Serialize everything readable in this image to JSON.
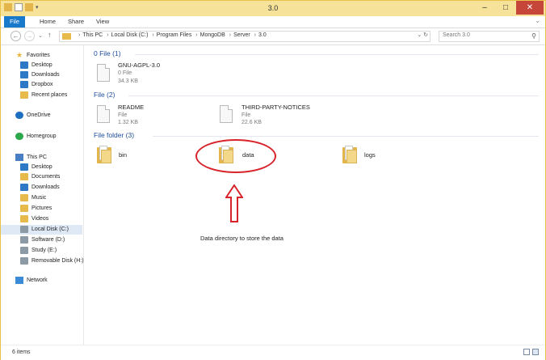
{
  "window": {
    "title": "3.0"
  },
  "ribbon": {
    "tabs": [
      "File",
      "Home",
      "Share",
      "View"
    ]
  },
  "address": {
    "crumbs": [
      "This PC",
      "Local Disk (C:)",
      "Program Files",
      "MongoDB",
      "Server",
      "3.0"
    ],
    "search_placeholder": "Search 3.0"
  },
  "nav": {
    "favorites": {
      "label": "Favorites",
      "items": [
        "Desktop",
        "Downloads",
        "Dropbox",
        "Recent places"
      ]
    },
    "onedrive": "OneDrive",
    "homegroup": "Homegroup",
    "thispc": {
      "label": "This PC",
      "items": [
        "Desktop",
        "Documents",
        "Downloads",
        "Music",
        "Pictures",
        "Videos",
        "Local Disk (C:)",
        "Software (D:)",
        "Study (E:)",
        "Removable Disk (H:)"
      ]
    },
    "network": "Network"
  },
  "groups": [
    {
      "header": "0 File (1)",
      "items": [
        {
          "name": "GNU-AGPL-3.0",
          "type": "0 File",
          "size": "34.3 KB"
        }
      ]
    },
    {
      "header": "File (2)",
      "items": [
        {
          "name": "README",
          "type": "File",
          "size": "1.32 KB"
        },
        {
          "name": "THIRD-PARTY-NOTICES",
          "type": "File",
          "size": "22.6 KB"
        }
      ]
    },
    {
      "header": "File folder (3)",
      "items": [
        {
          "name": "bin"
        },
        {
          "name": "data"
        },
        {
          "name": "logs"
        }
      ]
    }
  ],
  "annotation": {
    "text": "Data directory to store the data",
    "color": "#d8232a"
  },
  "status": {
    "count": "6 items"
  },
  "colors": {
    "accent": "#1979ca",
    "titlebar": "#f7e29a",
    "folder": "#e4b54a"
  }
}
